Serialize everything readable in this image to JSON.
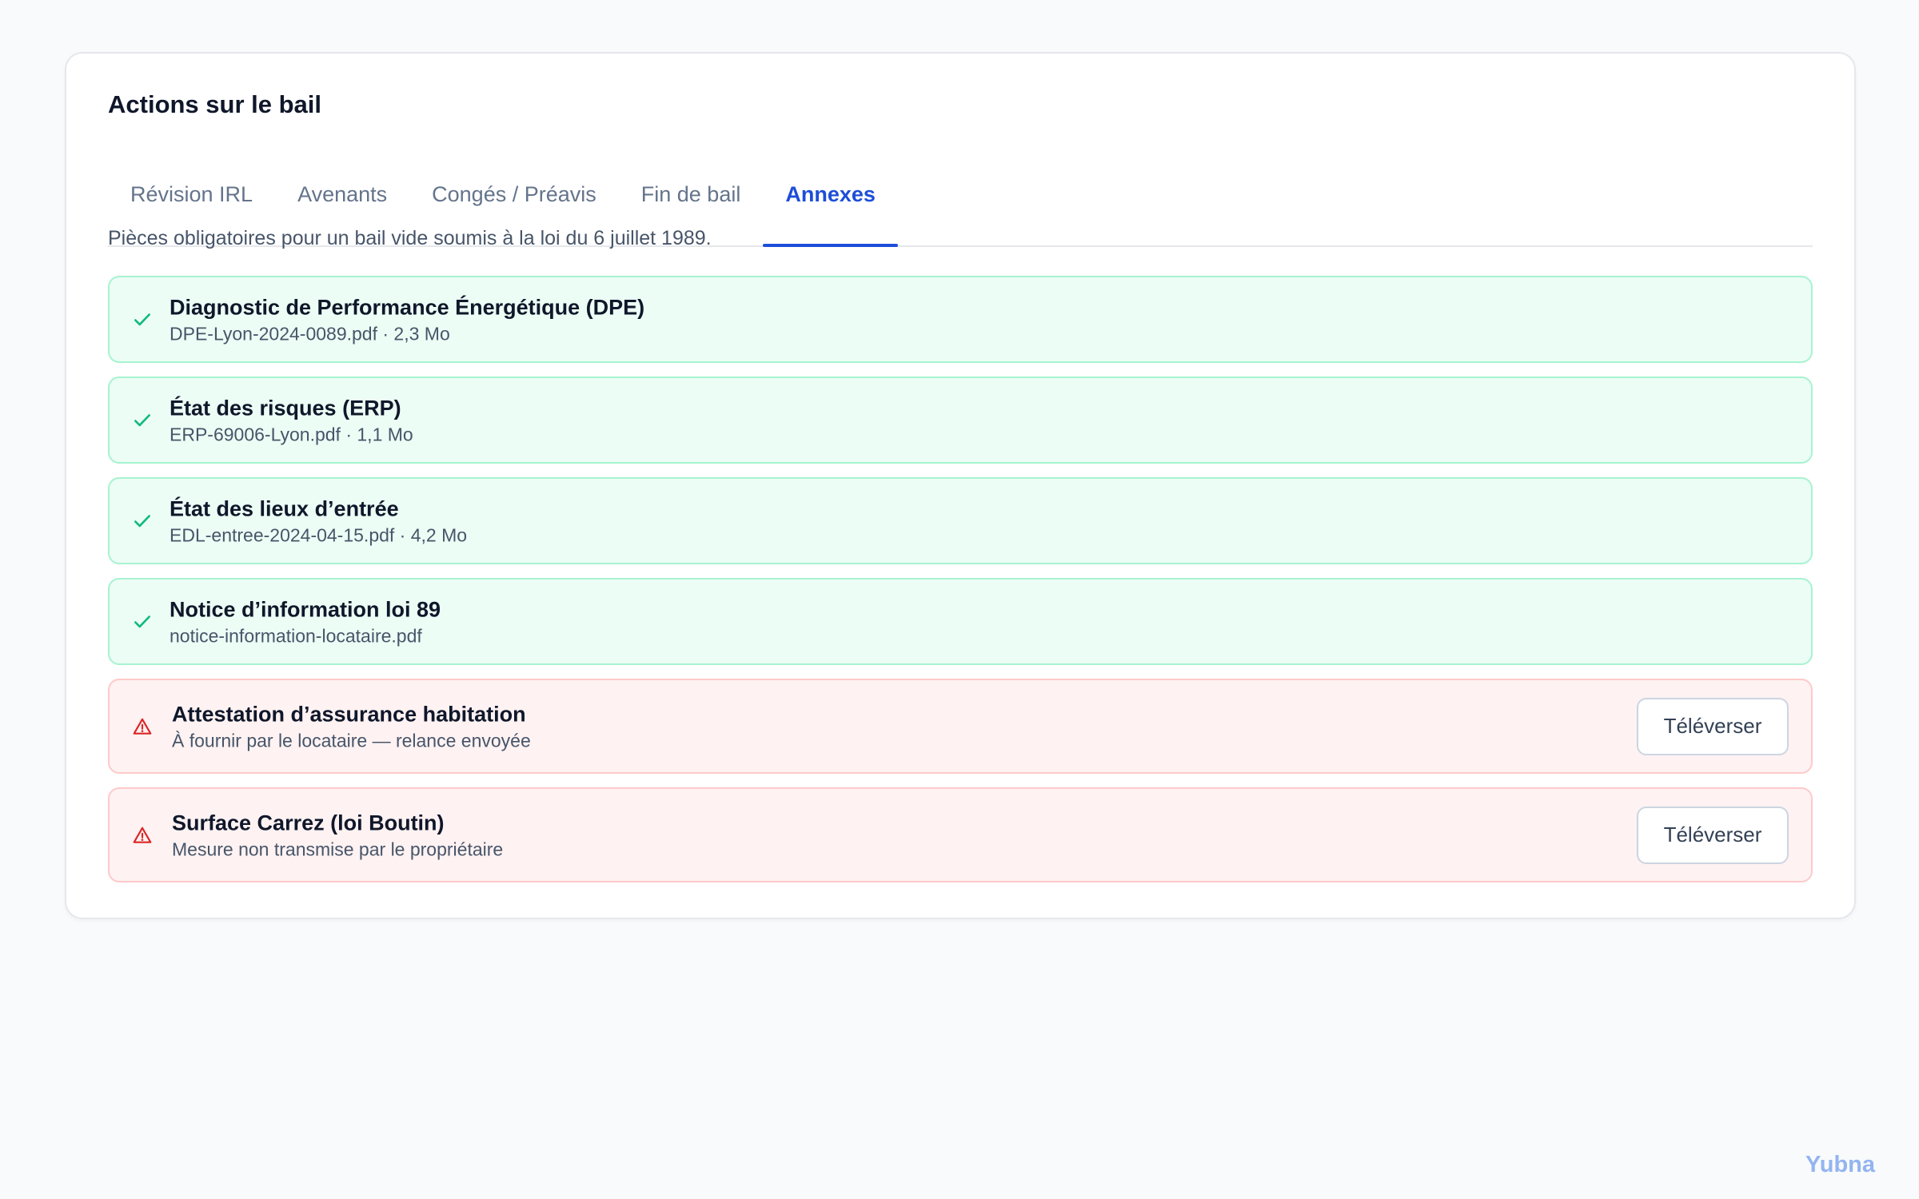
{
  "card": {
    "title": "Actions sur le bail",
    "tabs": [
      {
        "label": "Révision IRL",
        "active": false
      },
      {
        "label": "Avenants",
        "active": false
      },
      {
        "label": "Congés / Préavis",
        "active": false
      },
      {
        "label": "Fin de bail",
        "active": false
      },
      {
        "label": "Annexes",
        "active": true
      }
    ],
    "description": "Pièces obligatoires pour un bail vide soumis à la loi du 6 juillet 1989."
  },
  "annexes": [
    {
      "status": "ok",
      "icon": "check-icon",
      "name": "Diagnostic de Performance Énergétique (DPE)",
      "meta": "DPE-Lyon-2024-0089.pdf · 2,3 Mo"
    },
    {
      "status": "ok",
      "icon": "check-icon",
      "name": "État des risques (ERP)",
      "meta": "ERP-69006-Lyon.pdf · 1,1 Mo"
    },
    {
      "status": "ok",
      "icon": "check-icon",
      "name": "État des lieux d’entrée",
      "meta": "EDL-entree-2024-04-15.pdf · 4,2 Mo"
    },
    {
      "status": "ok",
      "icon": "check-icon",
      "name": "Notice d’information loi 89",
      "meta": "notice-information-locataire.pdf"
    },
    {
      "status": "missing",
      "icon": "warning-icon",
      "name": "Attestation d’assurance habitation",
      "meta": "À fournir par le locataire — relance envoyée",
      "action": "Téléverser"
    },
    {
      "status": "missing",
      "icon": "warning-icon",
      "name": "Surface Carrez (loi Boutin)",
      "meta": "Mesure non transmise par le propriétaire",
      "action": "Téléverser"
    }
  ],
  "colors": {
    "accent": "#1d4ed8",
    "ok_bg": "#ecfdf5",
    "ok_border": "#a7f3d0",
    "ok_icon": "#10b981",
    "missing_bg": "#fef2f2",
    "missing_border": "#fecaca",
    "missing_icon": "#dc2626"
  },
  "brand": "Yubna"
}
